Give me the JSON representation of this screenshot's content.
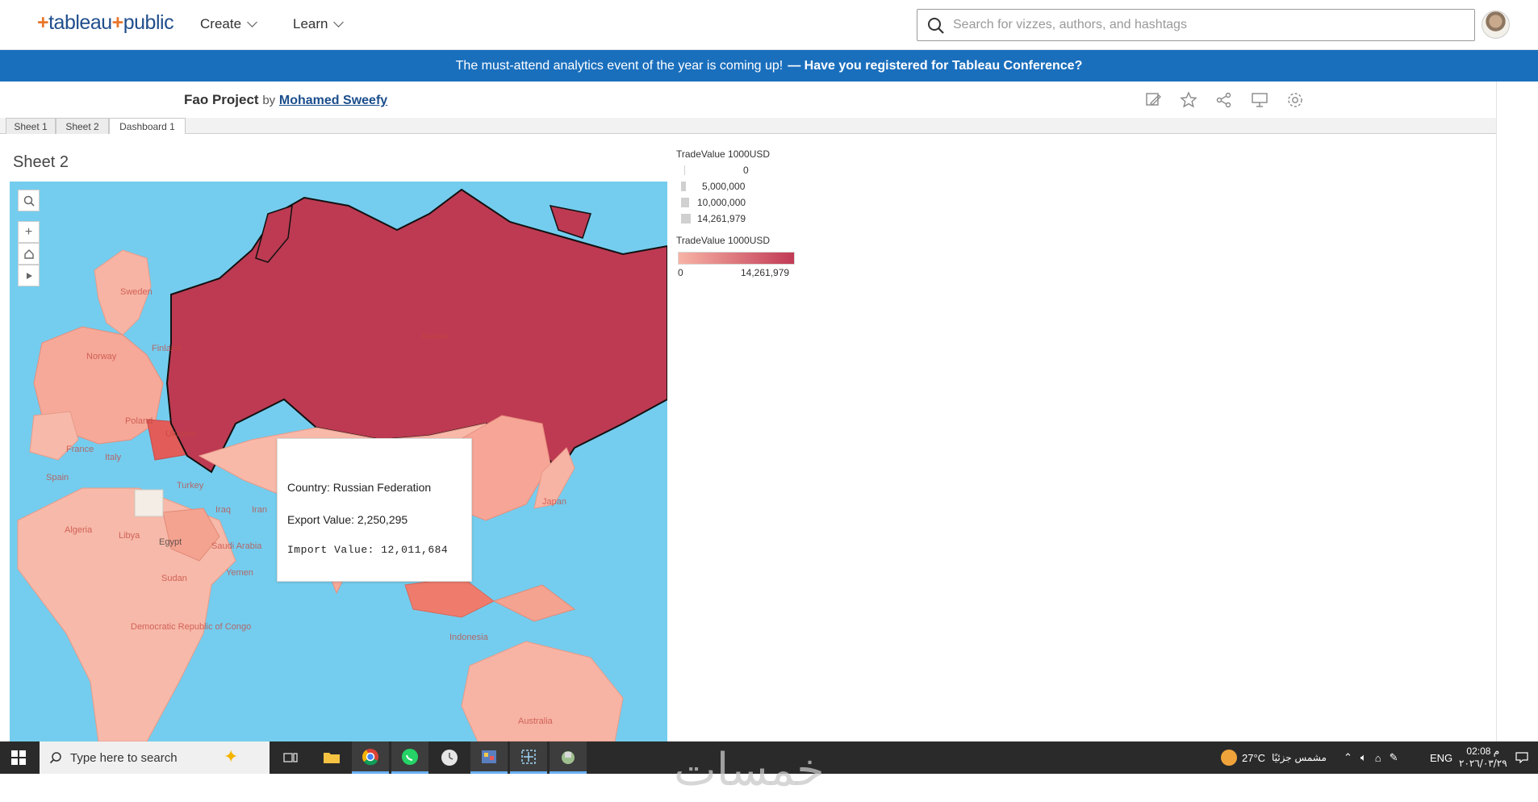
{
  "nav": {
    "logo_text": "tableau",
    "logo_plus": "+",
    "logo_public": "public",
    "create_label": "Create",
    "learn_label": "Learn",
    "search_placeholder": "Search for vizzes, authors, and hashtags"
  },
  "banner": {
    "text": "The must-attend analytics event of the year is coming up!",
    "link_text": "— Have you registered for Tableau Conference?"
  },
  "viz": {
    "project_name": "Fao Project",
    "by_label": "by",
    "author": "Mohamed Sweefy"
  },
  "tabs": [
    {
      "label": "Sheet 1"
    },
    {
      "label": "Sheet 2"
    },
    {
      "label": "Dashboard 1"
    }
  ],
  "sheet_title": "Sheet 2",
  "map": {
    "labels": [
      "Russia",
      "Sweden",
      "Finland",
      "Norway",
      "Poland",
      "Ukraine",
      "France",
      "Italy",
      "Spain",
      "Turkey",
      "Iraq",
      "Iran",
      "Algeria",
      "Libya",
      "Egypt",
      "Saudi Arabia",
      "Yemen",
      "Sudan",
      "Democratic Republic of Congo",
      "Japan",
      "Indonesia",
      "Australia"
    ],
    "ocean_color": "#74cdee",
    "high_color": "#bd3a52",
    "low_color": "#f7b9a9"
  },
  "tooltip": {
    "country_line": "Country: Russian Federation",
    "export_line": "Export Value: 2,250,295",
    "import_line": "Import Value: 12,011,684"
  },
  "legend": {
    "size_title": "TradeValue 1000USD",
    "size_items": [
      "0",
      "5,000,000",
      "10,000,000",
      "14,261,979"
    ],
    "color_title": "TradeValue 1000USD",
    "color_min": "0",
    "color_max": "14,261,979",
    "color_low": "#f8b3a5",
    "color_high": "#c13a55"
  },
  "taskbar": {
    "search_text": "Type here to search",
    "weather": "27°C",
    "weather_desc": "مشمس جزئيًا",
    "lang": "ENG",
    "time": "02:08 م",
    "date": "٢٠٢٦/٠٣/٢٩"
  },
  "watermark": "خمسات"
}
